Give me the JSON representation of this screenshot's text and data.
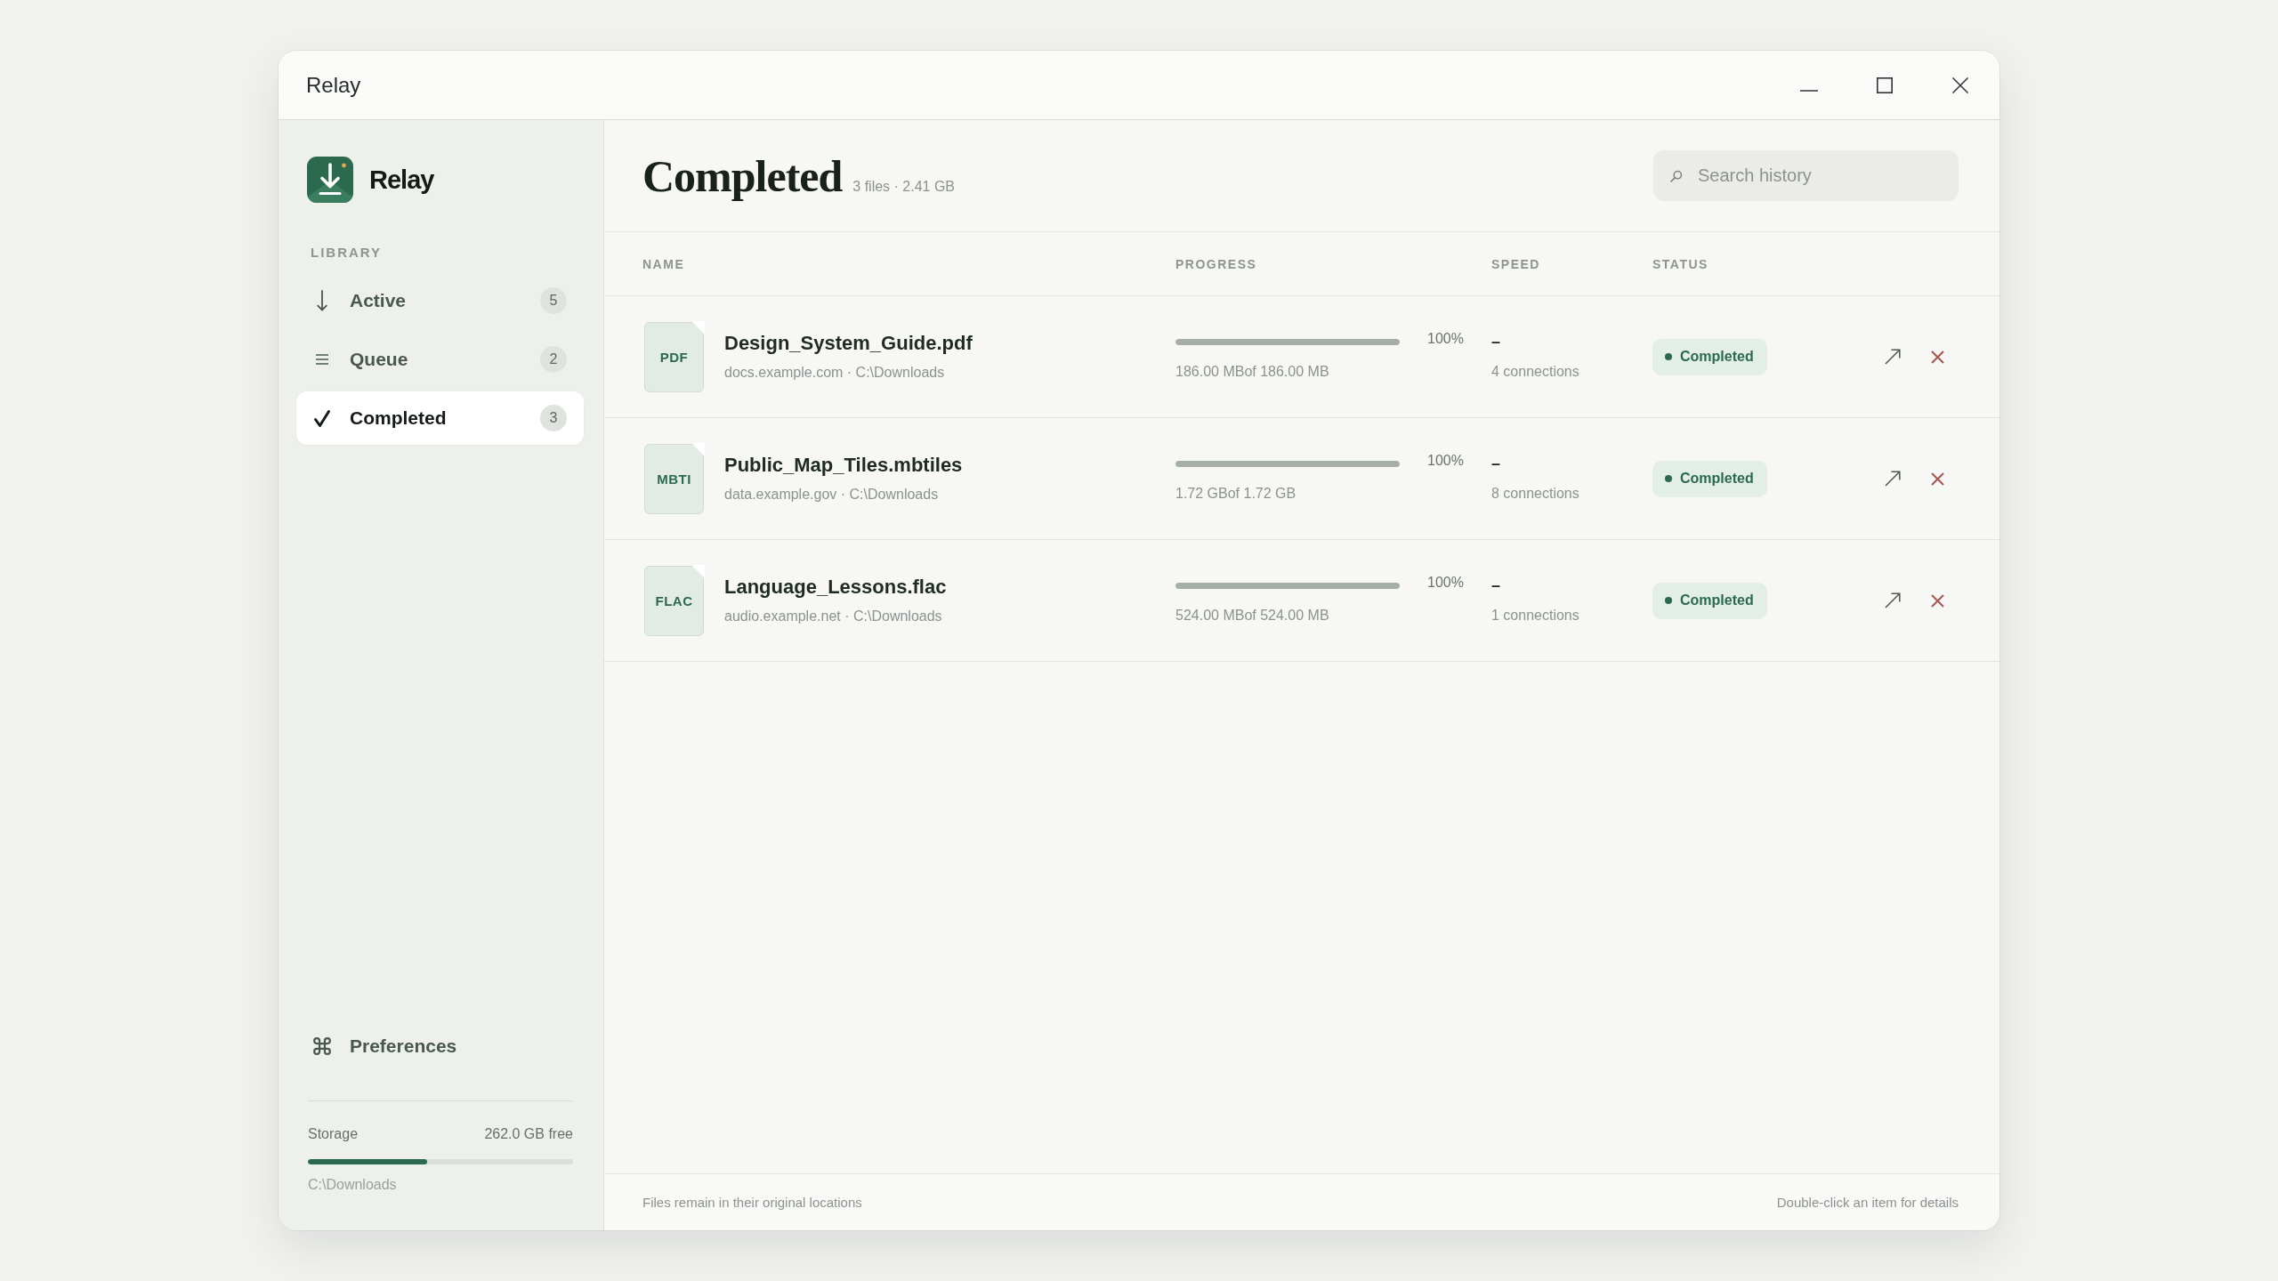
{
  "window": {
    "title": "Relay"
  },
  "sidebar": {
    "brand": "Relay",
    "section_label": "LIBRARY",
    "items": [
      {
        "label": "Active",
        "count": "5",
        "selected": false
      },
      {
        "label": "Queue",
        "count": "2",
        "selected": false
      },
      {
        "label": "Completed",
        "count": "3",
        "selected": true
      }
    ],
    "preferences": {
      "label": "Preferences"
    },
    "storage": {
      "label": "Storage",
      "free": "262.0 GB free",
      "level": 0.45,
      "path": "C:\\Downloads"
    }
  },
  "header": {
    "title": "Completed",
    "summary": "3 files · 2.41 GB",
    "search": {
      "placeholder": "Search history"
    }
  },
  "table": {
    "columns": [
      "NAME",
      "PROGRESS",
      "SPEED",
      "STATUS"
    ],
    "rows": [
      {
        "file_type": "PDF",
        "name": "Design_System_Guide.pdf",
        "source": "docs.example.com · C:\\Downloads",
        "level": 1,
        "percent": "100%",
        "transferred": "186.00 MBof 186.00 MB",
        "speed": "–",
        "connections": "4 connections",
        "status": "Completed"
      },
      {
        "file_type": "MBTI",
        "name": "Public_Map_Tiles.mbtiles",
        "source": "data.example.gov · C:\\Downloads",
        "level": 1,
        "percent": "100%",
        "transferred": "1.72 GBof 1.72 GB",
        "speed": "–",
        "connections": "8 connections",
        "status": "Completed"
      },
      {
        "file_type": "FLAC",
        "name": "Language_Lessons.flac",
        "source": "audio.example.net · C:\\Downloads",
        "level": 1,
        "percent": "100%",
        "transferred": "524.00 MBof 524.00 MB",
        "speed": "–",
        "connections": "1 connections",
        "status": "Completed"
      }
    ]
  },
  "status_bar": {
    "left": "Files remain in their original locations",
    "right": "Double-click an item for details"
  }
}
